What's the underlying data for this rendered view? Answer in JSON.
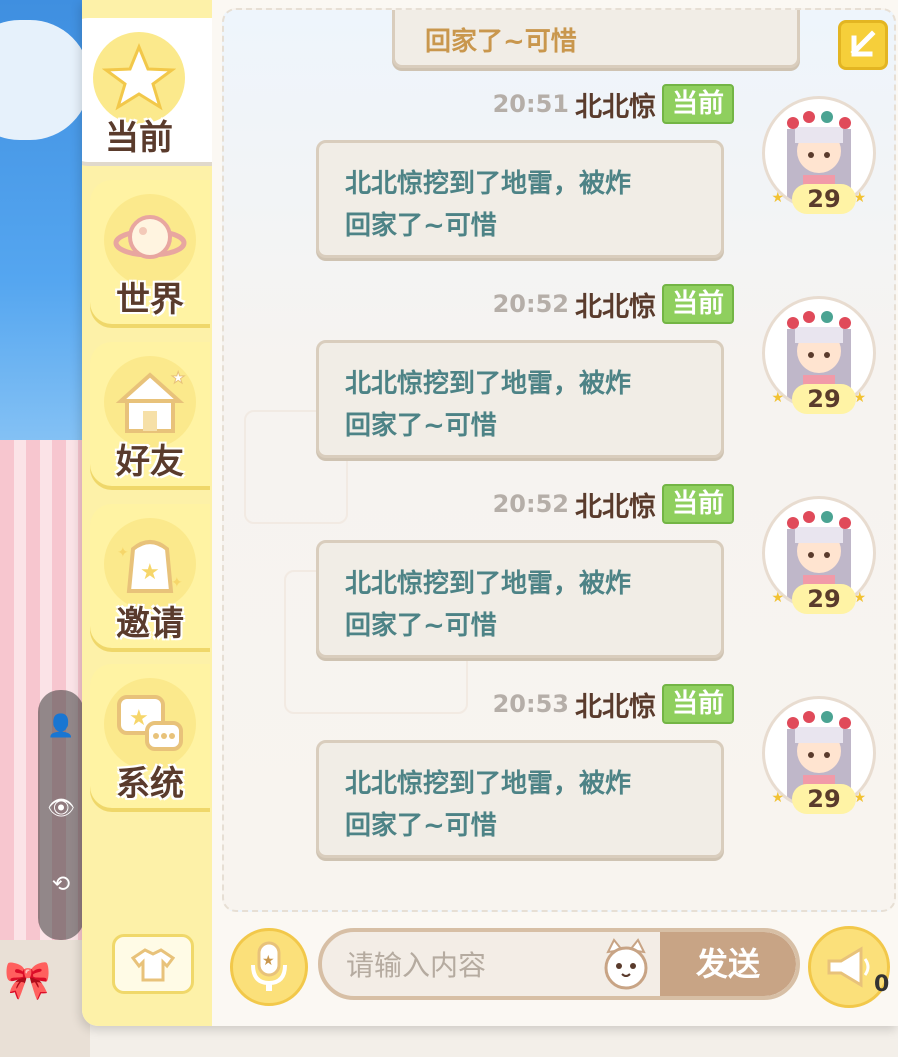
{
  "tabs": [
    {
      "label": "当前",
      "icon": "star-icon",
      "active": true
    },
    {
      "label": "世界",
      "icon": "planet-icon",
      "active": false
    },
    {
      "label": "好友",
      "icon": "house-icon",
      "active": false
    },
    {
      "label": "邀请",
      "icon": "gift-bag-icon",
      "active": false
    },
    {
      "label": "系统",
      "icon": "chat-bubble-icon",
      "active": false
    }
  ],
  "top_partial_message": "回家了~可惜",
  "messages": [
    {
      "time": "20:51",
      "nickname": "北北惊",
      "channel": "当前",
      "line1": "北北惊挖到了地雷，被炸",
      "line2": "回家了~可惜",
      "level": "29"
    },
    {
      "time": "20:52",
      "nickname": "北北惊",
      "channel": "当前",
      "line1": "北北惊挖到了地雷，被炸",
      "line2": "回家了~可惜",
      "level": "29"
    },
    {
      "time": "20:52",
      "nickname": "北北惊",
      "channel": "当前",
      "line1": "北北惊挖到了地雷，被炸",
      "line2": "回家了~可惜",
      "level": "29"
    },
    {
      "time": "20:53",
      "nickname": "北北惊",
      "channel": "当前",
      "line1": "北北惊挖到了地雷，被炸",
      "line2": "回家了~可惜",
      "level": "29"
    }
  ],
  "input": {
    "placeholder": "请输入内容",
    "value": ""
  },
  "send_label": "发送",
  "horn_count": "0",
  "colors": {
    "accent_yellow": "#fbe07a",
    "badge_green": "#8fcf5e",
    "message_text": "#4d8386",
    "nickname": "#5a3b2c"
  }
}
